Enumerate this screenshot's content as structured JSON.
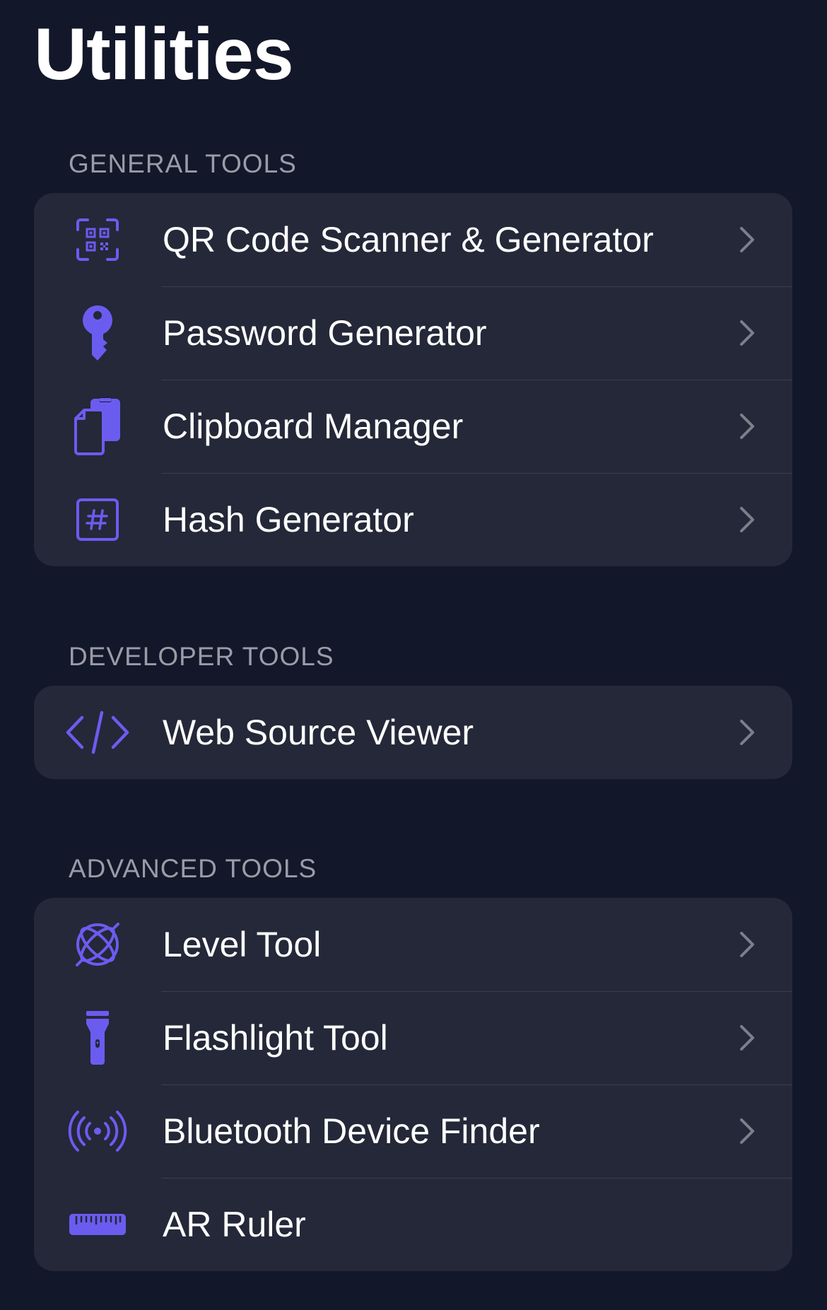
{
  "page": {
    "title": "Utilities"
  },
  "accent_color": "#6b5cf0",
  "sections": [
    {
      "header": "GENERAL TOOLS",
      "items": [
        {
          "label": "QR Code Scanner & Generator",
          "icon": "qr-code-icon"
        },
        {
          "label": "Password Generator",
          "icon": "key-icon"
        },
        {
          "label": "Clipboard Manager",
          "icon": "clipboard-icon"
        },
        {
          "label": "Hash Generator",
          "icon": "hash-icon"
        }
      ]
    },
    {
      "header": "DEVELOPER TOOLS",
      "items": [
        {
          "label": "Web Source Viewer",
          "icon": "code-icon"
        }
      ]
    },
    {
      "header": "ADVANCED TOOLS",
      "items": [
        {
          "label": "Level Tool",
          "icon": "level-gyroscope-icon"
        },
        {
          "label": "Flashlight Tool",
          "icon": "flashlight-icon"
        },
        {
          "label": "Bluetooth Device Finder",
          "icon": "broadcast-icon"
        },
        {
          "label": "AR Ruler",
          "icon": "ruler-icon"
        }
      ]
    }
  ]
}
